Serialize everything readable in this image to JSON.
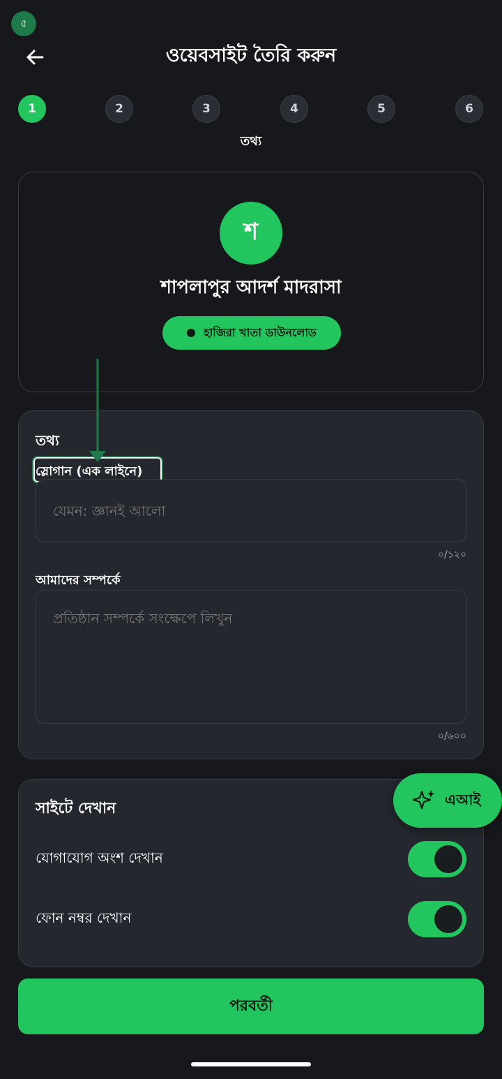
{
  "status_bar": {
    "badge_text": "৫"
  },
  "header": {
    "title": "ওয়েবসাইট তৈরি করুন",
    "back_icon": "arrow-left-icon"
  },
  "stepper": {
    "steps": [
      "1",
      "2",
      "3",
      "4",
      "5",
      "6"
    ],
    "active_index": 0,
    "current_label": "তথ্য"
  },
  "preview": {
    "logo_letter": "শ",
    "institution_name": "শাপলাপুর আদর্শ মাদরাসা",
    "download_label": "হাজিরা খাতা ডাউনলোড"
  },
  "info": {
    "section_title": "তথ্য",
    "slogan": {
      "label": "স্লোগান (এক লাইনে)",
      "placeholder": "যেমন: জ্ঞানই আলো",
      "value": "",
      "counter": "০/১২০"
    },
    "about": {
      "label": "আমাদের সম্পর্কে",
      "placeholder": "প্রতিষ্ঠান সম্পর্কে সংক্ষেপে লিখুন",
      "value": "",
      "counter": "০/৬০০"
    }
  },
  "visibility": {
    "section_title": "সাইটে দেখান",
    "toggles": [
      {
        "label": "যোগাযোগ অংশ দেখান",
        "on": true
      },
      {
        "label": "ফোন নম্বর দেখান",
        "on": true
      }
    ]
  },
  "ai_button": {
    "label": "এআই",
    "icon": "sparkles-icon"
  },
  "footer": {
    "next_label": "পরবর্তী"
  },
  "colors": {
    "accent": "#22c55e",
    "background": "#16181b",
    "card": "#24282e",
    "annotation": "#1f7a4a"
  }
}
